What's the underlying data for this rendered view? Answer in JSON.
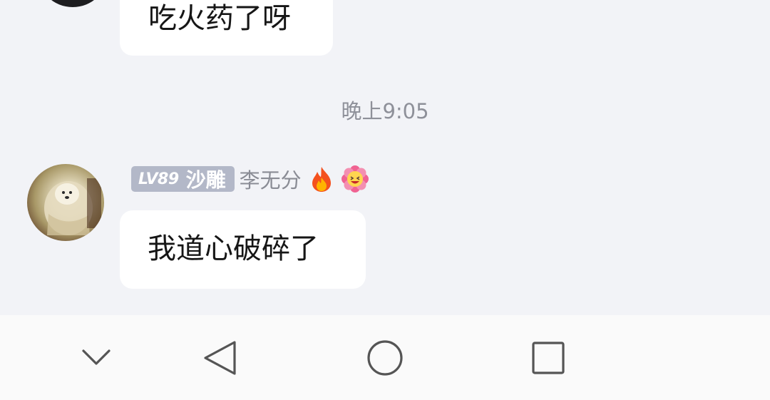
{
  "messages": {
    "previous": {
      "text": "吃火药了呀"
    },
    "time_divider": "晚上9:05",
    "current": {
      "sender": {
        "level": "LV89",
        "title": "沙雕",
        "name": "李无分",
        "badges": [
          "fire-emoji",
          "laughing-flower-emoji"
        ]
      },
      "text": "我道心破碎了"
    }
  },
  "navigation_bar": {
    "buttons": [
      "collapse-chevron-icon",
      "back-triangle-icon",
      "home-circle-icon",
      "recents-square-icon"
    ]
  },
  "colors": {
    "chat_background": "#f2f3f7",
    "bubble": "#ffffff",
    "level_badge": "#b3b8c8",
    "nav_background": "#fafafa",
    "nav_icon": "#555555"
  }
}
